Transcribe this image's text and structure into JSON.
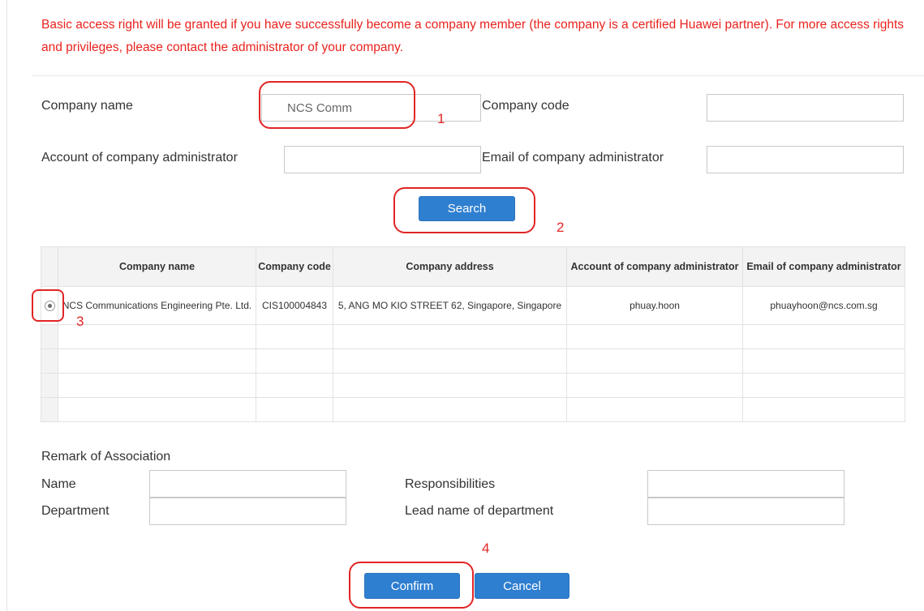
{
  "notice": "Basic access right will be granted if you have successfully become a company member (the company is a certified Huawei partner). For more access rights and privileges, please contact the administrator of your company.",
  "search_form": {
    "company_name_label": "Company name",
    "company_name_value": "NCS Comm",
    "company_code_label": "Company code",
    "company_code_value": "",
    "admin_account_label": "Account of company administrator",
    "admin_account_value": "",
    "admin_email_label": "Email of company administrator",
    "admin_email_value": "",
    "search_button": "Search"
  },
  "results_table": {
    "columns": [
      "Company name",
      "Company code",
      "Company address",
      "Account of company administrator",
      "Email of company administrator"
    ],
    "rows": [
      {
        "selected": true,
        "company_name": "NCS Communications Engineering Pte. Ltd.",
        "company_code": "CIS100004843",
        "company_address": "5, ANG MO KIO STREET 62, Singapore, Singapore",
        "admin_account": "phuay.hoon",
        "admin_email": "phuayhoon@ncs.com.sg"
      }
    ]
  },
  "remark": {
    "heading": "Remark of Association",
    "name_label": "Name",
    "name_value": "",
    "department_label": "Department",
    "department_value": "",
    "responsibilities_label": "Responsibilities",
    "responsibilities_value": "",
    "lead_label": "Lead name of department",
    "lead_value": ""
  },
  "actions": {
    "confirm": "Confirm",
    "cancel": "Cancel"
  },
  "annotations": {
    "step1": "1",
    "step2": "2",
    "step3": "3",
    "step4": "4"
  },
  "colors": {
    "notice": "#e8231e",
    "button": "#2f7fd0",
    "annotation": "#e12525"
  }
}
